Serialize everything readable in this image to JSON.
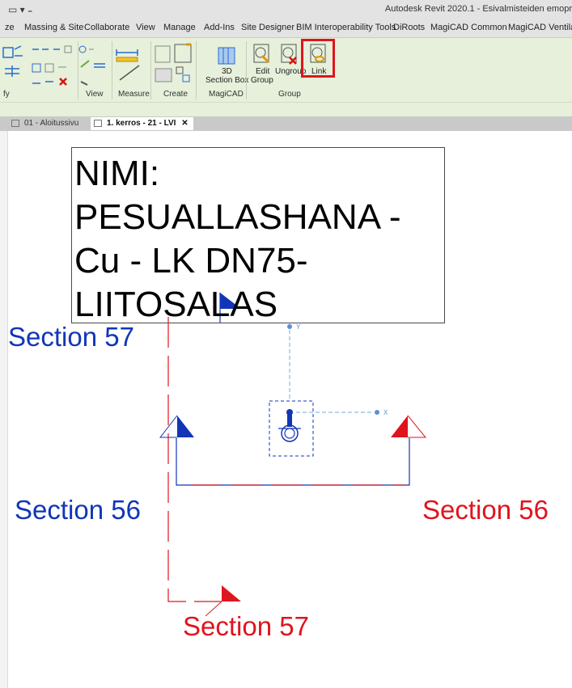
{
  "app": {
    "title": "Autodesk Revit 2020.1 - Esivalmisteiden emopr"
  },
  "ribbon_tabs": [
    "ze",
    "Massing & Site",
    "Collaborate",
    "View",
    "Manage",
    "Add-Ins",
    "Site Designer",
    "BIM Interoperability Tools",
    "DiRoots",
    "MagiCAD Common",
    "MagiCAD Ventilatio"
  ],
  "ribbon": {
    "groups": {
      "modify": "fy",
      "view": "View",
      "measure": "Measure",
      "create": "Create",
      "magicad": "MagiCAD",
      "group": "Group"
    },
    "buttons": {
      "section_box_line1": "3D",
      "section_box_line2": "Section Box",
      "edit_group_line1": "Edit",
      "edit_group_line2": "Group",
      "ungroup": "Ungroup",
      "link": "Link"
    }
  },
  "view_tabs": [
    {
      "label": "01 - Aloitussivu",
      "active": false
    },
    {
      "label": "1. kerros - 21 - LVI",
      "active": true,
      "close": "✕"
    }
  ],
  "canvas": {
    "name_tag": [
      "NIMI:",
      "PESUALLASHANA -",
      "Cu - LK DN75-",
      "LIITOSALAS"
    ],
    "sections": {
      "top_left": "Section 57",
      "left": "Section 56",
      "right": "Section 56",
      "bottom": "Section 57"
    },
    "axis_x": "X",
    "axis_y": "Y"
  },
  "colors": {
    "section_blue": "#1235b8",
    "section_red": "#e0141e",
    "ribbon_bg": "#e6f0da"
  }
}
